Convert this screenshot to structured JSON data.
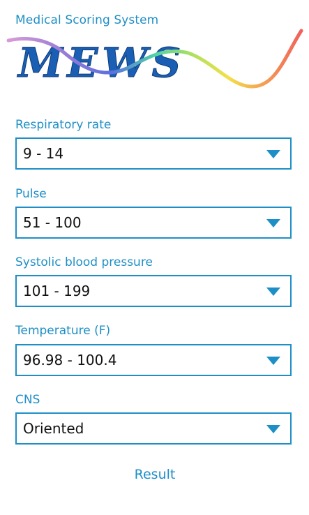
{
  "app": {
    "title": "Medical Scoring System",
    "logo_text": "MEWS"
  },
  "colors": {
    "accent": "#1e8fc6",
    "logo_text": "#1a5fb4",
    "text": "#111111"
  },
  "fields": [
    {
      "label": "Respiratory rate",
      "value": "9 - 14"
    },
    {
      "label": "Pulse",
      "value": "51 - 100"
    },
    {
      "label": "Systolic blood pressure",
      "value": "101 - 199"
    },
    {
      "label": "Temperature (F)",
      "value": "96.98 - 100.4"
    },
    {
      "label": "CNS",
      "value": "Oriented"
    }
  ],
  "actions": {
    "result_label": "Result"
  }
}
